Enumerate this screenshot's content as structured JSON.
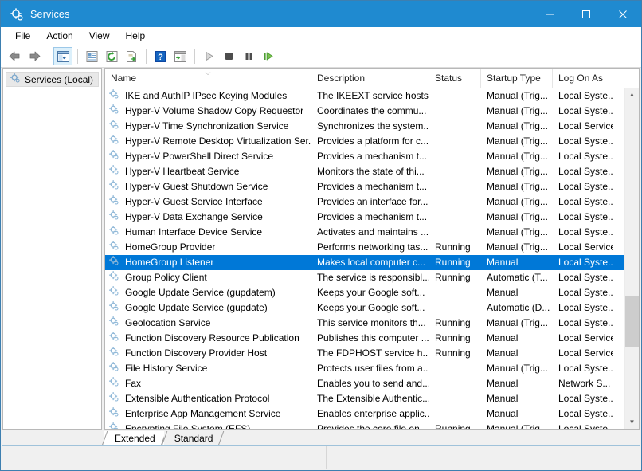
{
  "window": {
    "title": "Services",
    "title_icon": "services-gear-icon",
    "accent_color": "#1f8ad0",
    "selection_color": "#0078d7",
    "minimize_label": "Minimize",
    "maximize_label": "Maximize",
    "close_label": "Close"
  },
  "menubar": {
    "items": [
      {
        "label": "File"
      },
      {
        "label": "Action"
      },
      {
        "label": "View"
      },
      {
        "label": "Help"
      }
    ]
  },
  "toolbar": {
    "buttons": [
      {
        "name": "back-button",
        "icon": "left-arrow-icon"
      },
      {
        "name": "forward-button",
        "icon": "right-arrow-icon"
      },
      {
        "name": "show-hide-console-tree-button",
        "icon": "console-tree-icon"
      },
      {
        "name": "properties-button",
        "icon": "properties-icon"
      },
      {
        "name": "refresh-button",
        "icon": "refresh-icon"
      },
      {
        "name": "export-list-button",
        "icon": "export-list-icon"
      },
      {
        "name": "help-button",
        "icon": "help-icon"
      },
      {
        "name": "show-hide-action-pane-button",
        "icon": "action-pane-icon"
      },
      {
        "name": "start-service-button",
        "icon": "play-icon"
      },
      {
        "name": "stop-service-button",
        "icon": "stop-icon"
      },
      {
        "name": "pause-service-button",
        "icon": "pause-icon"
      },
      {
        "name": "restart-service-button",
        "icon": "restart-icon"
      }
    ]
  },
  "tree": {
    "nodes": [
      {
        "label": "Services (Local)",
        "icon": "services-gear-icon",
        "selected": true
      }
    ]
  },
  "list": {
    "sort_column": "Name",
    "sort_direction": "descending",
    "columns": [
      {
        "key": "name",
        "label": "Name"
      },
      {
        "key": "description",
        "label": "Description"
      },
      {
        "key": "status",
        "label": "Status"
      },
      {
        "key": "startup",
        "label": "Startup Type"
      },
      {
        "key": "logon",
        "label": "Log On As"
      }
    ],
    "rows": [
      {
        "name": "IKE and AuthIP IPsec Keying Modules",
        "description": "The IKEEXT service hosts...",
        "status": "",
        "startup": "Manual (Trig...",
        "logon": "Local Syste...",
        "selected": false
      },
      {
        "name": "Hyper-V Volume Shadow Copy Requestor",
        "description": "Coordinates the commu...",
        "status": "",
        "startup": "Manual (Trig...",
        "logon": "Local Syste...",
        "selected": false
      },
      {
        "name": "Hyper-V Time Synchronization Service",
        "description": "Synchronizes the system...",
        "status": "",
        "startup": "Manual (Trig...",
        "logon": "Local Service",
        "selected": false
      },
      {
        "name": "Hyper-V Remote Desktop Virtualization Ser...",
        "description": "Provides a platform for c...",
        "status": "",
        "startup": "Manual (Trig...",
        "logon": "Local Syste...",
        "selected": false
      },
      {
        "name": "Hyper-V PowerShell Direct Service",
        "description": "Provides a mechanism t...",
        "status": "",
        "startup": "Manual (Trig...",
        "logon": "Local Syste...",
        "selected": false
      },
      {
        "name": "Hyper-V Heartbeat Service",
        "description": "Monitors the state of thi...",
        "status": "",
        "startup": "Manual (Trig...",
        "logon": "Local Syste...",
        "selected": false
      },
      {
        "name": "Hyper-V Guest Shutdown Service",
        "description": "Provides a mechanism t...",
        "status": "",
        "startup": "Manual (Trig...",
        "logon": "Local Syste...",
        "selected": false
      },
      {
        "name": "Hyper-V Guest Service Interface",
        "description": "Provides an interface for...",
        "status": "",
        "startup": "Manual (Trig...",
        "logon": "Local Syste...",
        "selected": false
      },
      {
        "name": "Hyper-V Data Exchange Service",
        "description": "Provides a mechanism t...",
        "status": "",
        "startup": "Manual (Trig...",
        "logon": "Local Syste...",
        "selected": false
      },
      {
        "name": "Human Interface Device Service",
        "description": "Activates and maintains ...",
        "status": "",
        "startup": "Manual (Trig...",
        "logon": "Local Syste...",
        "selected": false
      },
      {
        "name": "HomeGroup Provider",
        "description": "Performs networking tas...",
        "status": "Running",
        "startup": "Manual (Trig...",
        "logon": "Local Service",
        "selected": false
      },
      {
        "name": "HomeGroup Listener",
        "description": "Makes local computer c...",
        "status": "Running",
        "startup": "Manual",
        "logon": "Local Syste...",
        "selected": true
      },
      {
        "name": "Group Policy Client",
        "description": "The service is responsibl...",
        "status": "Running",
        "startup": "Automatic (T...",
        "logon": "Local Syste...",
        "selected": false
      },
      {
        "name": "Google Update Service (gupdatem)",
        "description": "Keeps your Google soft...",
        "status": "",
        "startup": "Manual",
        "logon": "Local Syste...",
        "selected": false
      },
      {
        "name": "Google Update Service (gupdate)",
        "description": "Keeps your Google soft...",
        "status": "",
        "startup": "Automatic (D...",
        "logon": "Local Syste...",
        "selected": false
      },
      {
        "name": "Geolocation Service",
        "description": "This service monitors th...",
        "status": "Running",
        "startup": "Manual (Trig...",
        "logon": "Local Syste...",
        "selected": false
      },
      {
        "name": "Function Discovery Resource Publication",
        "description": "Publishes this computer ...",
        "status": "Running",
        "startup": "Manual",
        "logon": "Local Service",
        "selected": false
      },
      {
        "name": "Function Discovery Provider Host",
        "description": "The FDPHOST service h...",
        "status": "Running",
        "startup": "Manual",
        "logon": "Local Service",
        "selected": false
      },
      {
        "name": "File History Service",
        "description": "Protects user files from a...",
        "status": "",
        "startup": "Manual (Trig...",
        "logon": "Local Syste...",
        "selected": false
      },
      {
        "name": "Fax",
        "description": "Enables you to send and...",
        "status": "",
        "startup": "Manual",
        "logon": "Network S...",
        "selected": false
      },
      {
        "name": "Extensible Authentication Protocol",
        "description": "The Extensible Authentic...",
        "status": "",
        "startup": "Manual",
        "logon": "Local Syste...",
        "selected": false
      },
      {
        "name": "Enterprise App Management Service",
        "description": "Enables enterprise applic...",
        "status": "",
        "startup": "Manual",
        "logon": "Local Syste...",
        "selected": false
      },
      {
        "name": "Encrypting File System (EFS)",
        "description": "Provides the core file en...",
        "status": "Running",
        "startup": "Manual (Trig...",
        "logon": "Local Syste...",
        "selected": false
      }
    ]
  },
  "tabs": [
    {
      "label": "Extended",
      "active": true
    },
    {
      "label": "Standard",
      "active": false
    }
  ],
  "statusbar": {
    "left_text": "",
    "middle_text": "",
    "right_text": ""
  }
}
